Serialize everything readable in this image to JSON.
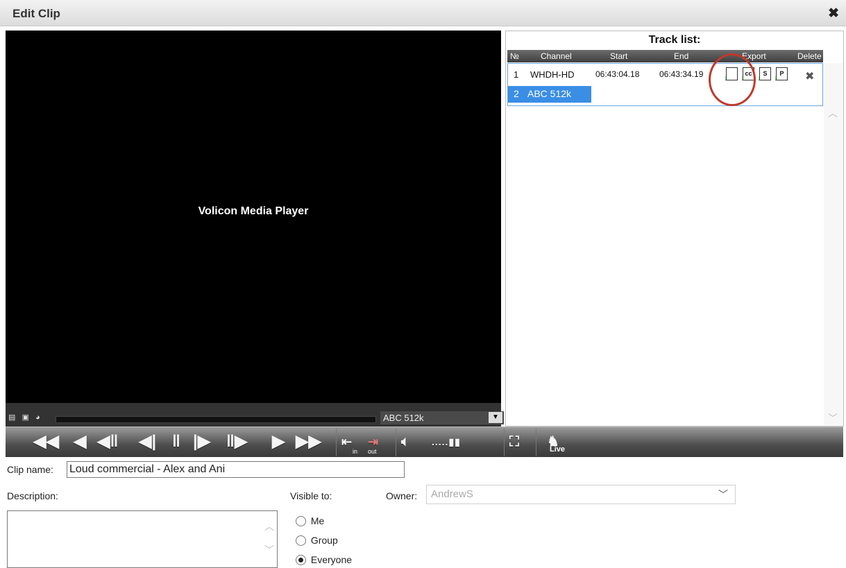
{
  "window": {
    "title": "Edit Clip",
    "close_glyph": "✖"
  },
  "player": {
    "caption": "Volicon Media Player",
    "channel_select": "ABC 512k",
    "icons": [
      "film-icon",
      "cc-icon",
      "clock-icon"
    ]
  },
  "controls": {
    "live_label": "Live",
    "in_label": "in",
    "out_label": "out"
  },
  "tracklist": {
    "heading": "Track list:",
    "columns": [
      "№",
      "Channel",
      "Start",
      "End",
      "Export",
      "Delete"
    ],
    "rows": [
      {
        "num": "1",
        "channel": "WHDH-HD",
        "start": "06:43:04.18",
        "end": "06:43:34.19",
        "export_icons": [
          "doc-export-icon",
          "cc-export-icon",
          "s-export-icon",
          "p-export-icon"
        ]
      },
      {
        "num": "2",
        "channel": "ABC 512k"
      }
    ]
  },
  "form": {
    "clip_name_label": "Clip name:",
    "clip_name_value": "Loud commercial - Alex and Ani",
    "description_label": "Description:",
    "visible_to_label": "Visible to:",
    "owner_label": "Owner:",
    "owner_value": "AndrewS",
    "visibility_options": [
      "Me",
      "Group",
      "Everyone"
    ],
    "visibility_selected": "Everyone"
  },
  "colors": {
    "selected_row": "#3a8ee6",
    "highlight_circle": "#c0392b",
    "export_arrow": "#2c9b2c"
  }
}
